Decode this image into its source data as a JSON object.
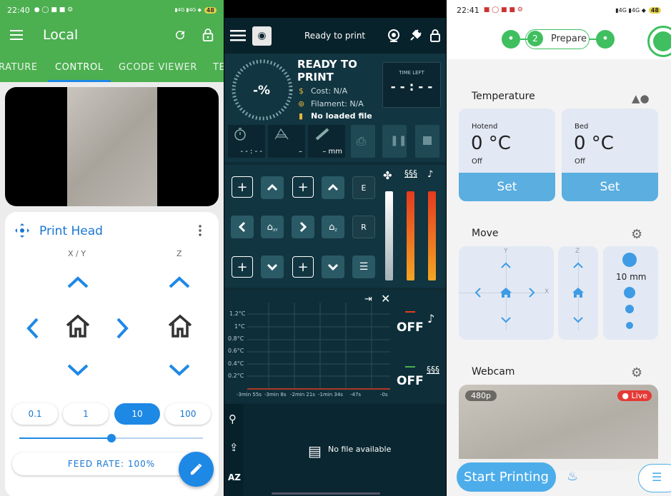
{
  "panel1": {
    "status": {
      "time": "22:40",
      "battery": "48"
    },
    "toolbar": {
      "title": "Local"
    },
    "tabs": [
      "RATURE",
      "CONTROL",
      "GCODE VIEWER",
      "TE"
    ],
    "card_title": "Print Head",
    "axis_labels": {
      "xy": "X / Y",
      "z": "Z"
    },
    "steps": [
      "0.1",
      "1",
      "10",
      "100"
    ],
    "selected_step": "10",
    "slider_value": 0.5,
    "feed_rate": "FEED RATE: 100%",
    "icons": [
      "menu-icon",
      "refresh-icon",
      "lock-icon",
      "move-icon",
      "more-vert-icon",
      "home-icon",
      "chevron-up-icon",
      "chevron-down-icon",
      "chevron-left-icon",
      "chevron-right-icon",
      "edit-icon"
    ],
    "accent": "#1e88e5",
    "bar_color": "#4caf50"
  },
  "panel2": {
    "header_status": "Ready to print",
    "state": "READY TO PRINT",
    "percent": "-%",
    "cost": "Cost: N/A",
    "filament": "Filament: N/A",
    "file": "No loaded file",
    "time_left_label": "TIME LEFT",
    "time_left": "- - : - -",
    "stats": [
      "- - : - -",
      "–",
      "– mm"
    ],
    "e_label": "E",
    "r_label": "R",
    "xy_sub": "XY",
    "z_sub": "Z",
    "heaters": [
      "OFF",
      "OFF"
    ],
    "y_ticks": [
      "1.2°C",
      "1°C",
      "0.8°C",
      "0.6°C",
      "0.4°C",
      "0.2°C"
    ],
    "x_ticks": [
      "-3min 55s",
      "-3min 8s",
      "-2min 21s",
      "-1min 34s",
      "-47s",
      "-0s"
    ],
    "files_label": "No file available",
    "bg": "#0f2c36"
  },
  "panel3": {
    "status": {
      "time": "22:41",
      "battery": "48"
    },
    "stepper": {
      "step": "2",
      "label": "Prepare"
    },
    "temperature_title": "Temperature",
    "hotend": {
      "label": "Hotend",
      "value": "0 °C",
      "state": "Off",
      "button": "Set"
    },
    "bed": {
      "label": "Bed",
      "value": "0 °C",
      "state": "Off",
      "button": "Set"
    },
    "move_title": "Move",
    "axis": {
      "y": "Y",
      "x": "X",
      "z": "Z"
    },
    "distance": "10 mm",
    "webcam_title": "Webcam",
    "resolution": "480p",
    "live": "Live",
    "start": "Start Printing",
    "accent": "#4dadea"
  }
}
